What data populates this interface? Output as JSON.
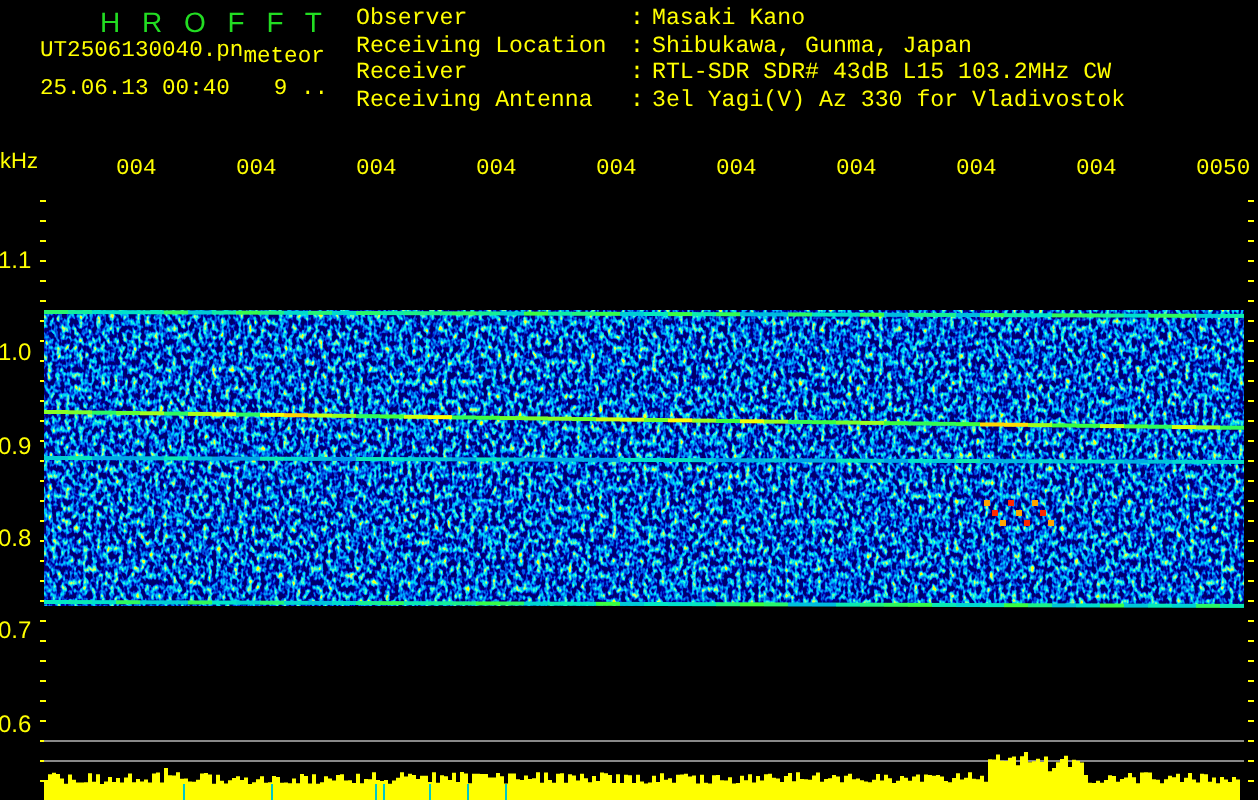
{
  "header": {
    "title": "H R O F F T",
    "filename": "UT2506130040.pn",
    "tag": "meteor",
    "timestamp": "25.06.13 00:40",
    "extra": "9 .."
  },
  "info": [
    {
      "label": "Observer",
      "sep": ":",
      "value": "Masaki Kano"
    },
    {
      "label": "Receiving Location",
      "sep": ":",
      "value": "Shibukawa, Gunma, Japan"
    },
    {
      "label": "Receiver",
      "sep": ":",
      "value": "RTL-SDR SDR# 43dB L15 103.2MHz CW"
    },
    {
      "label": "Receiving Antenna",
      "sep": ":",
      "value": "3el Yagi(V) Az 330 for Vladivostok"
    }
  ],
  "time_axis": {
    "labels": [
      "004",
      "004",
      "004",
      "004",
      "004",
      "004",
      "004",
      "004",
      "004",
      "0050"
    ]
  },
  "frequency_axis": {
    "unit": "kHz",
    "labels": [
      "1.1",
      "1.0",
      "0.9",
      "0.8",
      "0.7",
      "0.6"
    ]
  }
}
